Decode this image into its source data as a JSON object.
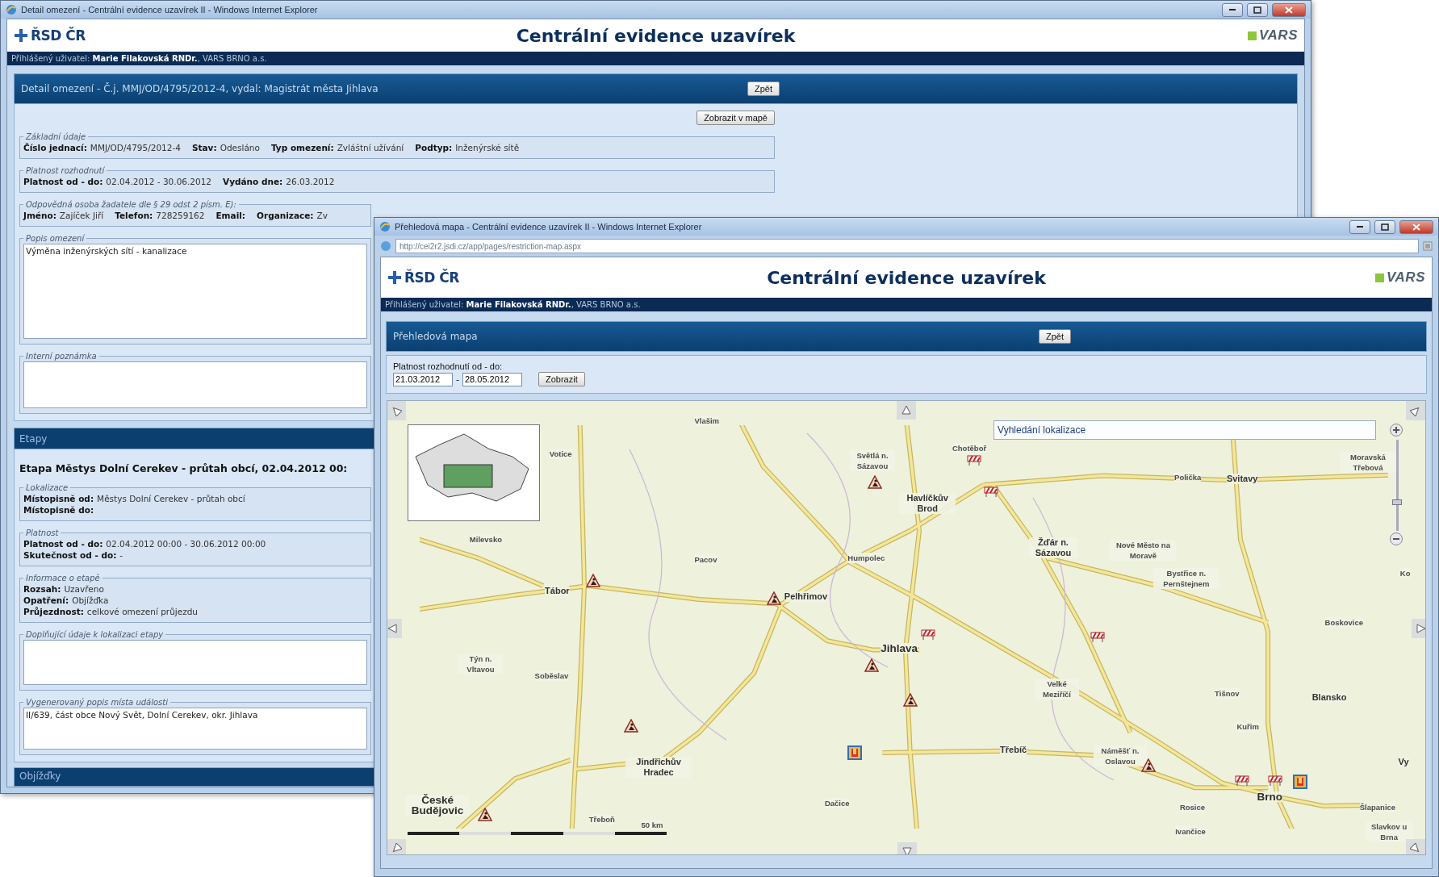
{
  "detail_window": {
    "title": "Detail omezení - Centrální evidence uzavírek II - Windows Internet Explorer",
    "header": {
      "logo": "ŘSD ČR",
      "title": "Centrální evidence uzavírek",
      "brand": "VARS"
    },
    "user_bar": "Přihlášený uživatel: **Marie Filakovská RNDr.**, VARS BRNO a.s.",
    "panel": {
      "title": "Detail omezení - Č.j. MMJ/OD/4795/2012-4, vydal: Magistrát města Jihlava",
      "back_button": "Zpět",
      "map_button": "Zobrazit v mapě",
      "sections": [
        {
          "kind": "fields",
          "legend": "Základní údaje",
          "rows": [
            [
              {
                "label": "Číslo jednací:",
                "value": "MMJ/OD/4795/2012-4"
              },
              {
                "label": "Stav:",
                "value": "Odesláno"
              },
              {
                "label": "Typ omezení:",
                "value": "Zvláštní užívání"
              },
              {
                "label": "Podtyp:",
                "value": "Inženýrské sítě"
              }
            ]
          ]
        },
        {
          "kind": "fields",
          "legend": "Platnost rozhodnutí",
          "rows": [
            [
              {
                "label": "Platnost od - do:",
                "value": "02.04.2012 - 30.06.2012"
              },
              {
                "label": "Vydáno dne:",
                "value": "26.03.2012"
              }
            ]
          ]
        },
        {
          "kind": "fields",
          "legend": "Odpovědná osoba žadatele dle § 29 odst 2 písm. E):",
          "rows": [
            [
              {
                "label": "Jméno:",
                "value": "Zajíček Jiří"
              },
              {
                "label": "Telefon:",
                "value": "728259162"
              },
              {
                "label": "Email:"
              },
              {
                "label": "Organizace:",
                "value": "Zv"
              }
            ]
          ]
        },
        {
          "kind": "text",
          "legend": "Popis omezení",
          "value": "Výměna inženýrských sítí - kanalizace"
        },
        {
          "kind": "text",
          "legend": "Interní poznámka"
        }
      ]
    },
    "stages": {
      "header": "Etapy",
      "title": "Etapa Městys Dolní Cerekev - průtah obcí, 02.04.2012 00:",
      "sections": [
        {
          "kind": "fields",
          "legend": "Lokalizace",
          "rows": [
            [
              {
                "label": "Místopisně od:",
                "value": "Městys Dolní Cerekev - průtah obcí"
              }
            ],
            [
              {
                "label": "Místopisně do:"
              }
            ]
          ]
        },
        {
          "kind": "fields",
          "legend": "Platnost",
          "rows": [
            [
              {
                "label": "Platnost od - do:",
                "value": "02.04.2012 00:00 - 30.06.2012 00:00"
              }
            ],
            [
              {
                "label": "Skutečnost od - do:",
                "value": "-"
              }
            ]
          ]
        },
        {
          "kind": "fields",
          "legend": "Informace o etapě",
          "rows": [
            [
              {
                "label": "Rozsah:",
                "value": "Uzavřeno"
              }
            ],
            [
              {
                "label": "Opatření:",
                "value": "Objížďka"
              }
            ],
            [
              {
                "label": "Průjezdnost:",
                "value": "celkové omezení průjezdu"
              }
            ]
          ]
        },
        {
          "kind": "text",
          "legend": "Doplňující údaje k lokalizaci etapy"
        },
        {
          "kind": "text",
          "legend": "Vygenerovaný popis místa události",
          "value": "II/639, část obce Nový Svět, Dolní Cerekev, okr. Jihlava"
        }
      ]
    },
    "detours_header": "Objížďky"
  },
  "map_window": {
    "title": "Přehledová mapa - Centrální evidence uzavírek II - Windows Internet Explorer",
    "address": "http://cei2r2.jsdi.cz/app/pages/restriction-map.aspx",
    "header": {
      "logo": "ŘSD ČR",
      "title": "Centrální evidence uzavírek",
      "brand": "VARS"
    },
    "user_bar": "Přihlášený uživatel: **Marie Filakovská RNDr.**, VARS BRNO a.s.",
    "panel": {
      "title": "Přehledová mapa",
      "back_button": "Zpět"
    },
    "filter": {
      "label": "Platnost rozhodnutí od - do:",
      "from": "21.03.2012",
      "separator": "-",
      "to": "28.05.2012",
      "button": "Zobrazit"
    },
    "map": {
      "search_placeholder": "Vyhledání lokalizace",
      "zoom": {
        "level": 0.3
      },
      "scale_label": "50 km",
      "places": [
        {
          "name": "Vlašim",
          "kind": "town"
        },
        {
          "name": "Votice",
          "kind": "town"
        },
        {
          "name": "Světlá n. Sázavou",
          "kind": "town"
        },
        {
          "name": "Chotěboř",
          "kind": "town"
        },
        {
          "name": "Havlíčkův Brod",
          "kind": "city"
        },
        {
          "name": "Polička",
          "kind": "town"
        },
        {
          "name": "Svitavy",
          "kind": "city"
        },
        {
          "name": "Moravská Třebová",
          "kind": "town"
        },
        {
          "name": "Milevsko",
          "kind": "town"
        },
        {
          "name": "Pacov",
          "kind": "town"
        },
        {
          "name": "Humpolec",
          "kind": "town"
        },
        {
          "name": "Žďár n. Sázavou",
          "kind": "city"
        },
        {
          "name": "Nové Město na Moravě",
          "kind": "town"
        },
        {
          "name": "Bystřice n. Pernštejnem",
          "kind": "town"
        },
        {
          "name": "Ko",
          "kind": "town"
        },
        {
          "name": "Tábor",
          "kind": "city"
        },
        {
          "name": "Pelhřimov",
          "kind": "city"
        },
        {
          "name": "Boskovice",
          "kind": "town"
        },
        {
          "name": "Jihlava",
          "kind": "major"
        },
        {
          "name": "Týn n. Vltavou",
          "kind": "town"
        },
        {
          "name": "Soběslav",
          "kind": "town"
        },
        {
          "name": "Velké Meziříčí",
          "kind": "town"
        },
        {
          "name": "Tišnov",
          "kind": "town"
        },
        {
          "name": "Blansko",
          "kind": "city"
        },
        {
          "name": "Kuřim",
          "kind": "town"
        },
        {
          "name": "Třebíč",
          "kind": "city"
        },
        {
          "name": "Náměšť n. Oslavou",
          "kind": "town"
        },
        {
          "name": "Jindřichův Hradec",
          "kind": "city"
        },
        {
          "name": "Vy",
          "kind": "city"
        },
        {
          "name": "Dačice",
          "kind": "town"
        },
        {
          "name": "Rosice",
          "kind": "town"
        },
        {
          "name": "Brno",
          "kind": "major"
        },
        {
          "name": "Šlapanice",
          "kind": "town"
        },
        {
          "name": "Ivančice",
          "kind": "town"
        },
        {
          "name": "Slavkov u Brna",
          "kind": "town"
        },
        {
          "name": "České Budějovic",
          "kind": "major"
        },
        {
          "name": "Třeboň",
          "kind": "town"
        }
      ]
    }
  }
}
